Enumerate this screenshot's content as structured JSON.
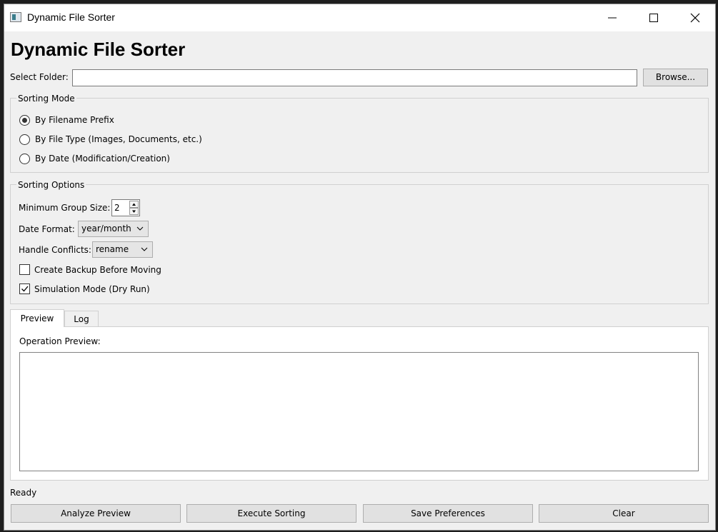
{
  "window": {
    "title": "Dynamic File Sorter"
  },
  "header": {
    "title": "Dynamic File Sorter"
  },
  "folder": {
    "label": "Select Folder:",
    "value": "",
    "browse_label": "Browse..."
  },
  "sorting_mode": {
    "title": "Sorting Mode",
    "options": [
      {
        "label": "By Filename Prefix",
        "checked": true
      },
      {
        "label": "By File Type (Images, Documents, etc.)",
        "checked": false
      },
      {
        "label": "By Date (Modification/Creation)",
        "checked": false
      }
    ]
  },
  "sorting_options": {
    "title": "Sorting Options",
    "min_group_label": "Minimum Group Size:",
    "min_group_value": "2",
    "date_format_label": "Date Format:",
    "date_format_value": "year/month",
    "conflicts_label": "Handle Conflicts:",
    "conflicts_value": "rename",
    "backup_label": "Create Backup Before Moving",
    "backup_checked": false,
    "simulation_label": "Simulation Mode (Dry Run)",
    "simulation_checked": true
  },
  "tabs": [
    {
      "label": "Preview",
      "active": true
    },
    {
      "label": "Log",
      "active": false
    }
  ],
  "preview": {
    "label": "Operation Preview:",
    "content": ""
  },
  "status": {
    "text": "Ready"
  },
  "buttons": {
    "analyze": "Analyze  Preview",
    "execute": "Execute Sorting",
    "save": "Save Preferences",
    "clear": "Clear"
  }
}
